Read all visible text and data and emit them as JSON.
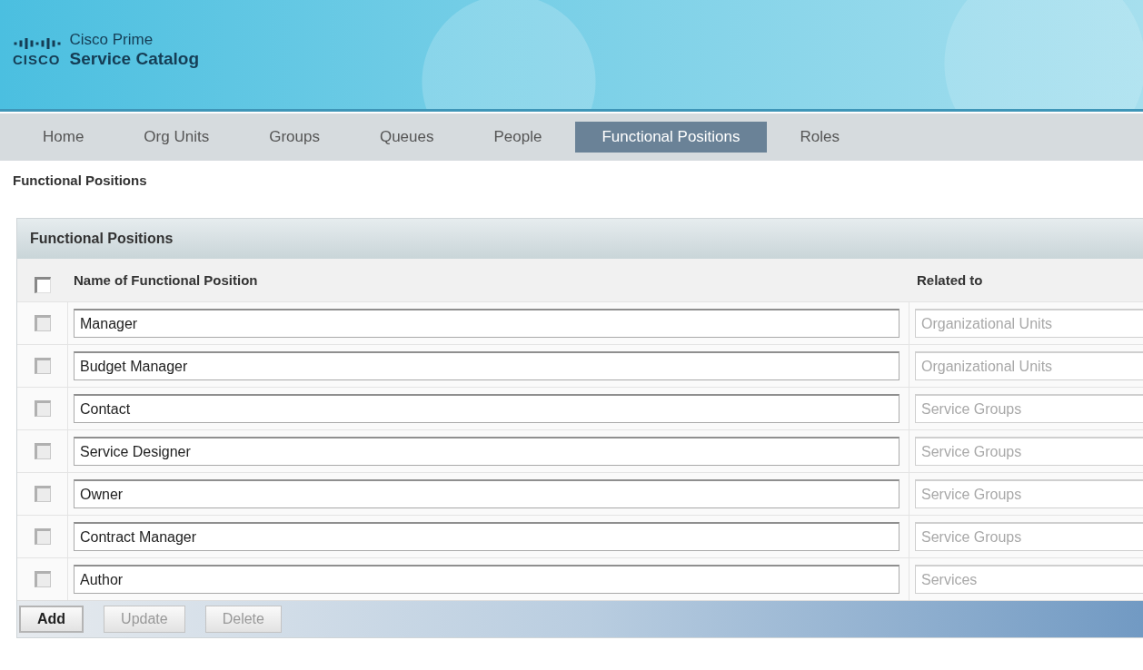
{
  "header": {
    "logo_word": "CISCO",
    "product_line": "Cisco Prime",
    "product_name": "Service Catalog"
  },
  "tabs": [
    {
      "label": "Home",
      "selected": false
    },
    {
      "label": "Org Units",
      "selected": false
    },
    {
      "label": "Groups",
      "selected": false
    },
    {
      "label": "Queues",
      "selected": false
    },
    {
      "label": "People",
      "selected": false
    },
    {
      "label": "Functional Positions",
      "selected": true
    },
    {
      "label": "Roles",
      "selected": false
    }
  ],
  "page_title": "Functional Positions",
  "panel": {
    "title": "Functional Positions",
    "columns": [
      "Name of Functional Position",
      "Related to"
    ],
    "select_all_checked": false,
    "rows": [
      {
        "checked": false,
        "name": "Manager",
        "related_to": "Organizational Units",
        "related_disabled": true
      },
      {
        "checked": false,
        "name": "Budget Manager",
        "related_to": "Organizational Units",
        "related_disabled": true
      },
      {
        "checked": false,
        "name": "Contact",
        "related_to": "Service Groups",
        "related_disabled": true
      },
      {
        "checked": false,
        "name": "Service Designer",
        "related_to": "Service Groups",
        "related_disabled": true
      },
      {
        "checked": false,
        "name": "Owner",
        "related_to": "Service Groups",
        "related_disabled": true
      },
      {
        "checked": false,
        "name": "Contract Manager",
        "related_to": "Service Groups",
        "related_disabled": true
      },
      {
        "checked": false,
        "name": "Author",
        "related_to": "Services",
        "related_disabled": true
      }
    ],
    "buttons": [
      {
        "label": "Add",
        "disabled": false
      },
      {
        "label": "Update",
        "disabled": true
      },
      {
        "label": "Delete",
        "disabled": true
      }
    ]
  }
}
